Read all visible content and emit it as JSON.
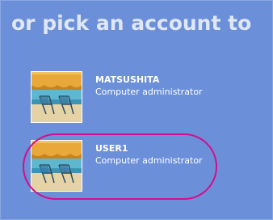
{
  "heading": "or pick an account to",
  "accounts": [
    {
      "name": "MATSUSHITA",
      "role": "Computer administrator",
      "picture": "beach-chairs-icon"
    },
    {
      "name": "USER1",
      "role": "Computer administrator",
      "picture": "beach-chairs-icon",
      "highlighted": true
    }
  ],
  "colors": {
    "background": "#6b8fd8",
    "heading": "#dfe7f7",
    "highlight_ring": "#d40e8a"
  }
}
